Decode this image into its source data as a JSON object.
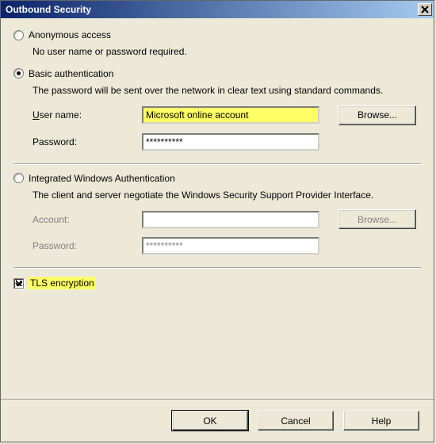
{
  "window": {
    "title": "Outbound Security"
  },
  "anon": {
    "label": "Anonymous access",
    "desc": "No user name or password required.",
    "selected": false
  },
  "basic": {
    "label": "Basic authentication",
    "desc": "The password will be sent over the network in clear text using standard commands.",
    "selected": true,
    "user_label": "User name:",
    "user_value": "Microsoft online account",
    "pass_label": "Password:",
    "pass_value": "**********",
    "browse_label": "Browse..."
  },
  "iwa": {
    "label": "Integrated Windows Authentication",
    "desc": "The client and server negotiate the Windows Security Support Provider Interface.",
    "selected": false,
    "acct_label": "Account:",
    "acct_value": "",
    "pass_label": "Password:",
    "pass_value": "**********",
    "browse_label": "Browse..."
  },
  "tls": {
    "label": "TLS encryption",
    "checked": true
  },
  "buttons": {
    "ok": "OK",
    "cancel": "Cancel",
    "help": "Help"
  }
}
